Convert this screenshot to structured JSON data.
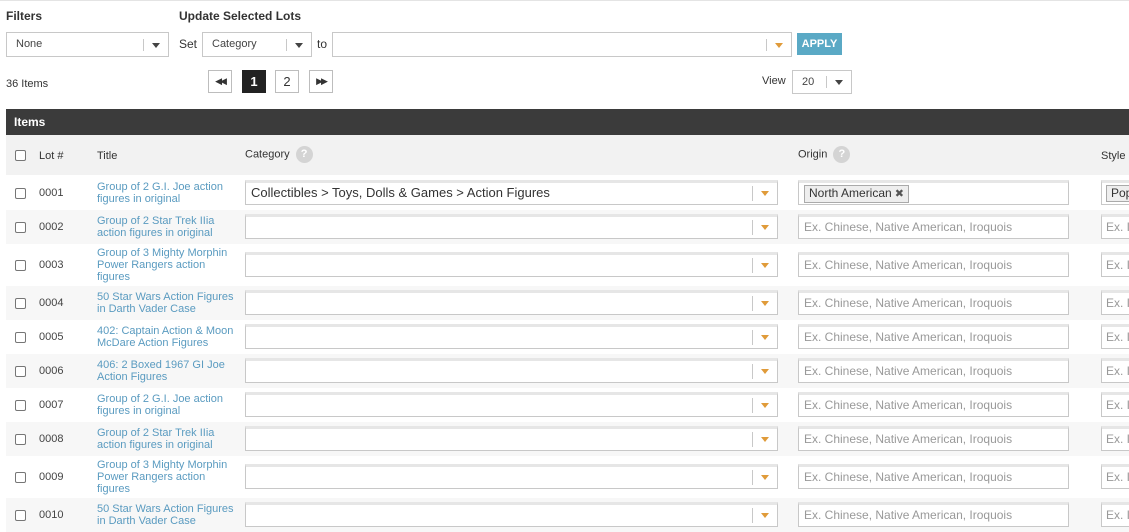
{
  "filters": {
    "label": "Filters",
    "selected": "None"
  },
  "update": {
    "label": "Update Selected Lots",
    "set_label": "Set",
    "field_selected": "Category",
    "to_label": "to",
    "value": "",
    "apply_label": "APPLY"
  },
  "count_label": "36 Items",
  "pagination": {
    "first": "◀◀",
    "pages": [
      "1",
      "2"
    ],
    "active_page": "1",
    "last": "▶▶"
  },
  "view": {
    "label": "View",
    "selected": "20"
  },
  "table": {
    "title": "Items",
    "headers": {
      "lot": "Lot #",
      "title": "Title",
      "category": "Category",
      "origin": "Origin",
      "style": "Style"
    },
    "help_icon": "?",
    "origin_placeholder": "Ex. Chinese, Native American, Iroquois",
    "style_placeholder": "Ex. I",
    "rows": [
      {
        "lot": "0001",
        "title": "Group of 2 G.I. Joe action figures in original",
        "category": "Collectibles > Toys, Dolls & Games > Action Figures",
        "origin_tag": "North American",
        "style_tag": "Pop"
      },
      {
        "lot": "0002",
        "title": "Group of 2 Star Trek IIia action figures in original",
        "category": "",
        "origin_tag": "",
        "style_tag": ""
      },
      {
        "lot": "0003",
        "title": "Group of 3 Mighty Morphin Power Rangers action figures",
        "category": "",
        "origin_tag": "",
        "style_tag": ""
      },
      {
        "lot": "0004",
        "title": "50 Star Wars Action Figures in Darth Vader Case",
        "category": "",
        "origin_tag": "",
        "style_tag": ""
      },
      {
        "lot": "0005",
        "title": "402: Captain Action & Moon McDare Action Figures",
        "category": "",
        "origin_tag": "",
        "style_tag": ""
      },
      {
        "lot": "0006",
        "title": "406: 2 Boxed 1967 GI Joe Action Figures",
        "category": "",
        "origin_tag": "",
        "style_tag": ""
      },
      {
        "lot": "0007",
        "title": "Group of 2 G.I. Joe action figures in original",
        "category": "",
        "origin_tag": "",
        "style_tag": ""
      },
      {
        "lot": "0008",
        "title": "Group of 2 Star Trek IIia action figures in original",
        "category": "",
        "origin_tag": "",
        "style_tag": ""
      },
      {
        "lot": "0009",
        "title": "Group of 3 Mighty Morphin Power Rangers action figures",
        "category": "",
        "origin_tag": "",
        "style_tag": ""
      },
      {
        "lot": "0010",
        "title": "50 Star Wars Action Figures in Darth Vader Case",
        "category": "",
        "origin_tag": "",
        "style_tag": ""
      }
    ]
  },
  "colors": {
    "link": "#5a9bc0",
    "apply": "#5aa9c5",
    "header_bar": "#3b3b3b",
    "dropdown_caret": "#e09b3a"
  }
}
